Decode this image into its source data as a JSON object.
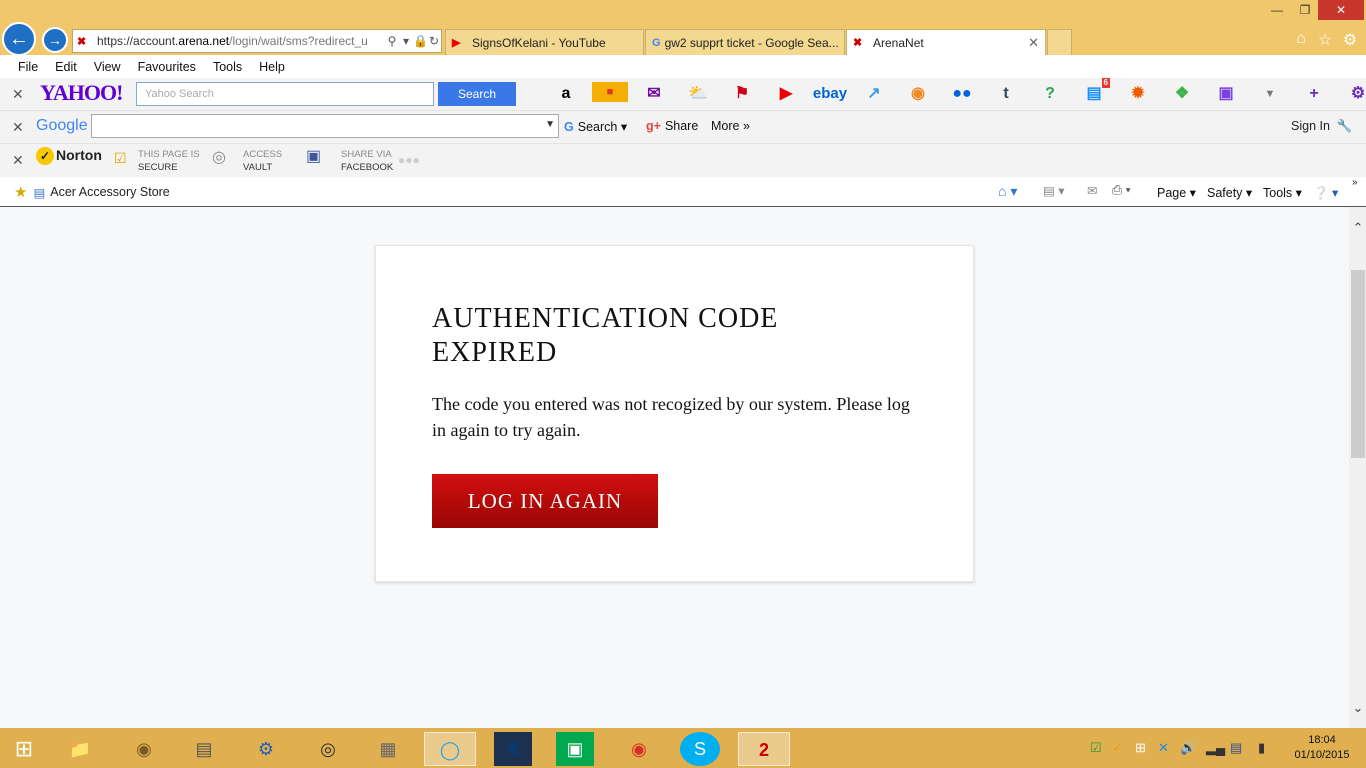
{
  "browser": {
    "url": "https://account.arena.net/login/wait/sms?redirect_u",
    "url_prefix": "https://account.",
    "url_domain": "arena.net",
    "url_path": "/login/wait/sms?redirect_u",
    "tabs": [
      {
        "label": "SignsOfKelani - YouTube",
        "icon": "youtube-icon"
      },
      {
        "label": "gw2 supprt ticket - Google Sea...",
        "icon": "google-icon"
      },
      {
        "label": "ArenaNet",
        "icon": "arenanet-icon",
        "active": true
      }
    ]
  },
  "menu": [
    "File",
    "Edit",
    "View",
    "Favourites",
    "Tools",
    "Help"
  ],
  "yahoo_bar": {
    "logo": "YAHOO!",
    "placeholder": "Yahoo Search",
    "button": "Search",
    "icons": [
      "amazon-icon",
      "ebay-icon",
      "mail-icon",
      "weather-icon",
      "bookmark-icon",
      "youtube-icon",
      "ebay-text-icon",
      "finance-icon",
      "basketball-icon",
      "flickr-icon",
      "tumblr-icon",
      "answers-icon",
      "news-icon",
      "sun-icon",
      "tag-icon",
      "movies-icon",
      "dropdown-icon",
      "plus-icon",
      "settings-icon"
    ],
    "ebay_label": "ebay",
    "news_badge": "6"
  },
  "google_bar": {
    "logo": "Google",
    "search": "Search",
    "share": "Share",
    "more": "More",
    "sign_in": "Sign In"
  },
  "norton_bar": {
    "logo": "Norton",
    "secure_top": "THIS PAGE IS",
    "secure_bottom": "SECURE",
    "vault_top": "ACCESS",
    "vault_bottom": "VAULT",
    "share_top": "SHARE VIA",
    "share_bottom": "FACEBOOK"
  },
  "favourites_bar": {
    "item": "Acer Accessory Store",
    "page": "Page",
    "safety": "Safety",
    "tools": "Tools"
  },
  "card": {
    "title": "AUTHENTICATION CODE EXPIRED",
    "message": "The code you entered was not recogized by our system. Please log in again to try again.",
    "button": "LOG IN AGAIN"
  },
  "taskbar": {
    "time": "18:04",
    "date": "01/10/2015"
  },
  "colors": {
    "titlebar": "#f0c86b",
    "button_red": "#c10a0a",
    "yahoo_purple": "#5f01d1",
    "taskbar": "#e0b050"
  }
}
